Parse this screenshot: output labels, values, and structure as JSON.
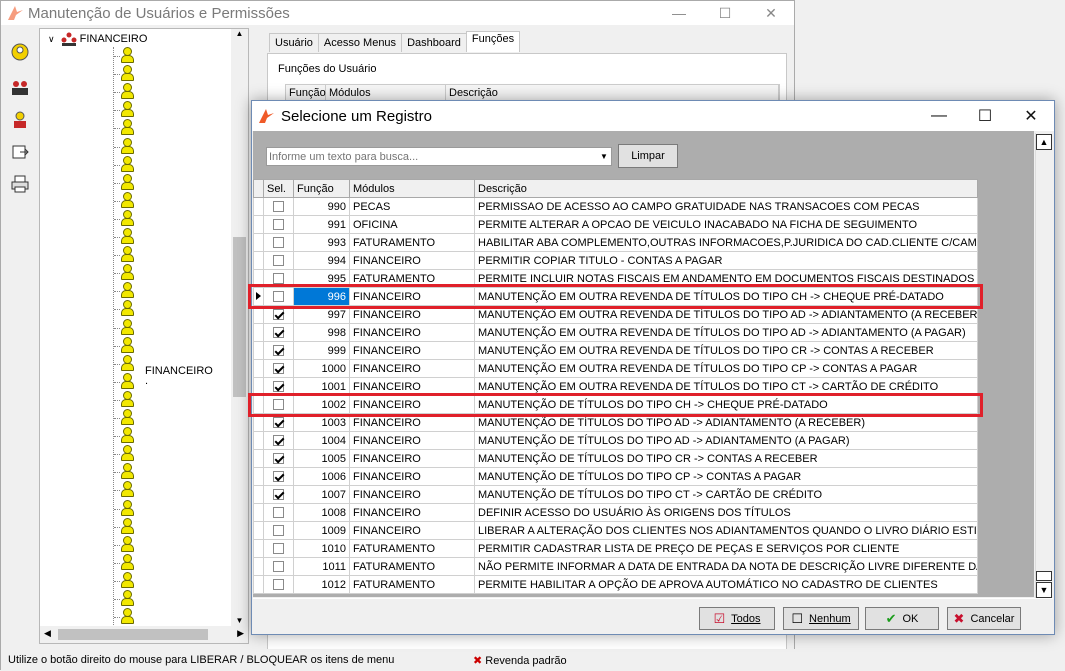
{
  "main_window": {
    "title": "Manutenção de Usuários e Permissões",
    "controls": [
      "—",
      "☐",
      "✕"
    ]
  },
  "tree": {
    "root_label": "FINANCEIRO",
    "group_label": "FINANCEIRO",
    "group_sub": "."
  },
  "tabs": [
    "Usuário",
    "Acesso Menus",
    "Dashboard",
    "Funções"
  ],
  "functions_panel": {
    "caption": "Funções do Usuário",
    "columns": [
      "Função",
      "Módulos",
      "Descrição"
    ]
  },
  "status_bar": {
    "hint": "Utilize o botão direito do mouse para LIBERAR / BLOQUEAR os itens de menu",
    "revenda": "Revenda padrão"
  },
  "dialog": {
    "title": "Selecione um Registro",
    "controls": [
      "—",
      "☐",
      "✕"
    ],
    "search_placeholder": "Informe um texto para busca...",
    "clear_button": "Limpar",
    "columns": [
      "Sel.",
      "Função",
      "Módulos",
      "Descrição"
    ],
    "rows": [
      {
        "checked": false,
        "code": "990",
        "module": "PECAS",
        "description": "PERMISSAO DE ACESSO AO CAMPO GRATUIDADE NAS TRANSACOES COM PECAS"
      },
      {
        "checked": false,
        "code": "991",
        "module": "OFICINA",
        "description": "PERMITE ALTERAR A OPCAO DE VEICULO INACABADO NA FICHA DE SEGUIMENTO"
      },
      {
        "checked": false,
        "code": "993",
        "module": "FATURAMENTO",
        "description": "HABILITAR ABA COMPLEMENTO,OUTRAS INFORMACOES,P.JURIDICA DO CAD.CLIENTE C/CAMPOS TRI"
      },
      {
        "checked": false,
        "code": "994",
        "module": "FINANCEIRO",
        "description": "PERMITIR COPIAR TITULO - CONTAS A PAGAR"
      },
      {
        "checked": false,
        "code": "995",
        "module": "FATURAMENTO",
        "description": "PERMITE INCLUIR NOTAS FISCAIS EM ANDAMENTO EM DOCUMENTOS FISCAIS DESTINADOS"
      },
      {
        "checked": false,
        "code": "996",
        "module": "FINANCEIRO",
        "description": "MANUTENÇÃO EM OUTRA REVENDA DE TÍTULOS DO TIPO CH -> CHEQUE PRÉ-DATADO",
        "current": true
      },
      {
        "checked": true,
        "code": "997",
        "module": "FINANCEIRO",
        "description": "MANUTENÇÃO EM OUTRA REVENDA DE TÍTULOS DO TIPO AD -> ADIANTAMENTO (A RECEBER)"
      },
      {
        "checked": true,
        "code": "998",
        "module": "FINANCEIRO",
        "description": "MANUTENÇÃO EM OUTRA REVENDA DE TÍTULOS DO TIPO AD -> ADIANTAMENTO (A PAGAR)"
      },
      {
        "checked": true,
        "code": "999",
        "module": "FINANCEIRO",
        "description": "MANUTENÇÃO EM OUTRA REVENDA DE TÍTULOS DO TIPO CR -> CONTAS A RECEBER"
      },
      {
        "checked": true,
        "code": "1000",
        "module": "FINANCEIRO",
        "description": "MANUTENÇÃO EM OUTRA REVENDA DE TÍTULOS DO TIPO CP -> CONTAS A PAGAR"
      },
      {
        "checked": true,
        "code": "1001",
        "module": "FINANCEIRO",
        "description": "MANUTENÇÃO EM OUTRA REVENDA DE TÍTULOS DO TIPO CT -> CARTÃO DE CRÉDITO"
      },
      {
        "checked": false,
        "code": "1002",
        "module": "FINANCEIRO",
        "description": "MANUTENÇÃO DE TÍTULOS DO TIPO CH -> CHEQUE PRÉ-DATADO"
      },
      {
        "checked": true,
        "code": "1003",
        "module": "FINANCEIRO",
        "description": "MANUTENÇÃO DE TÍTULOS DO TIPO AD -> ADIANTAMENTO (A RECEBER)"
      },
      {
        "checked": true,
        "code": "1004",
        "module": "FINANCEIRO",
        "description": "MANUTENÇÃO DE TÍTULOS DO TIPO AD -> ADIANTAMENTO (A PAGAR)"
      },
      {
        "checked": true,
        "code": "1005",
        "module": "FINANCEIRO",
        "description": "MANUTENÇÃO DE TÍTULOS DO TIPO CR -> CONTAS A RECEBER"
      },
      {
        "checked": true,
        "code": "1006",
        "module": "FINANCEIRO",
        "description": "MANUTENÇÃO DE TÍTULOS DO TIPO CP -> CONTAS A PAGAR"
      },
      {
        "checked": true,
        "code": "1007",
        "module": "FINANCEIRO",
        "description": "MANUTENÇÃO DE TÍTULOS DO TIPO CT -> CARTÃO DE CRÉDITO"
      },
      {
        "checked": false,
        "code": "1008",
        "module": "FINANCEIRO",
        "description": "DEFINIR ACESSO DO USUÁRIO ÀS ORIGENS DOS TÍTULOS"
      },
      {
        "checked": false,
        "code": "1009",
        "module": "FINANCEIRO",
        "description": "LIBERAR A ALTERAÇÃO DOS CLIENTES NOS ADIANTAMENTOS QUANDO O LIVRO DIÁRIO ESTIVER FECH"
      },
      {
        "checked": false,
        "code": "1010",
        "module": "FATURAMENTO",
        "description": "PERMITIR CADASTRAR LISTA DE PREÇO DE PEÇAS E SERVIÇOS POR CLIENTE"
      },
      {
        "checked": false,
        "code": "1011",
        "module": "FATURAMENTO",
        "description": "NÃO PERMITE INFORMAR A DATA DE ENTRADA DA NOTA DE DESCRIÇÃO LIVRE DIFERENTE DA DATA A"
      },
      {
        "checked": false,
        "code": "1012",
        "module": "FATURAMENTO",
        "description": "PERMITE HABILITAR A OPÇÃO DE APROVA AUTOMÁTICO NO CADASTRO DE CLIENTES"
      }
    ],
    "buttons": {
      "all": "Todos",
      "none": "Nenhum",
      "ok": "OK",
      "cancel": "Cancelar"
    }
  },
  "colors": {
    "highlight_box": "#e0202a",
    "current_cell": "#0078d7",
    "grid_band": "#adadad"
  }
}
